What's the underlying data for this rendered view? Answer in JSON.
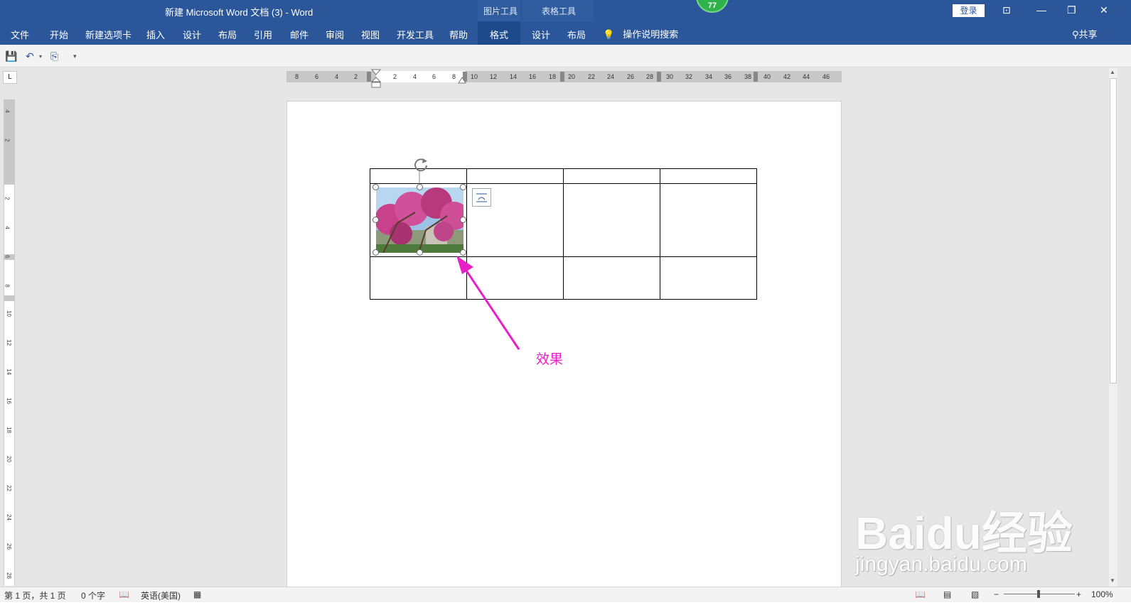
{
  "window": {
    "title": "新建 Microsoft Word 文档 (3)  -  Word",
    "context_picture": "图片工具",
    "context_table": "表格工具",
    "badge": "77",
    "login": "登录"
  },
  "ribbon": {
    "tabs": [
      "文件",
      "开始",
      "新建选项卡",
      "插入",
      "设计",
      "布局",
      "引用",
      "邮件",
      "审阅",
      "视图",
      "开发工具",
      "帮助",
      "格式",
      "设计",
      "布局"
    ],
    "active_tab": "格式",
    "tell_me": "操作说明搜索",
    "share": "共享"
  },
  "ruler": {
    "h_numbers": [
      "8",
      "6",
      "4",
      "2",
      "2",
      "4",
      "6",
      "8",
      "10",
      "12",
      "14",
      "16",
      "18",
      "20",
      "22",
      "24",
      "26",
      "28",
      "30",
      "32",
      "34",
      "36",
      "38",
      "40",
      "42",
      "44",
      "46"
    ],
    "v_numbers": [
      "4",
      "2",
      "2",
      "4",
      "6",
      "8",
      "10",
      "12",
      "14",
      "16",
      "18",
      "20",
      "22",
      "24",
      "26",
      "28"
    ],
    "tab_selector": "L"
  },
  "document": {
    "annotation": "效果"
  },
  "watermark": {
    "line1": "Baidu经验",
    "line2": "jingyan.baidu.com"
  },
  "status": {
    "page": "第 1 页，共 1 页",
    "words": "0 个字",
    "language": "英语(美国)",
    "zoom": "100%"
  },
  "colors": {
    "ribbon": "#2b579a",
    "annotation": "#e91ec8",
    "badge": "#2db34a"
  }
}
